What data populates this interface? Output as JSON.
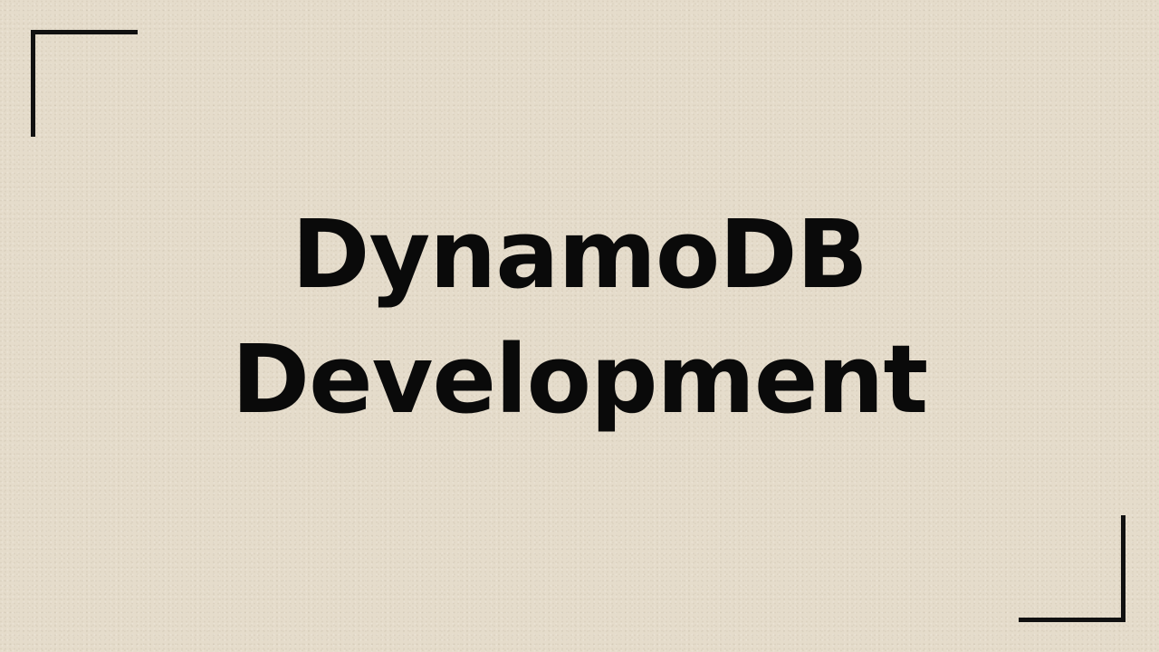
{
  "slide": {
    "title_line_1": "DynamoDB",
    "title_line_2": "Development"
  },
  "colors": {
    "background": "#e5dccb",
    "text": "#0a0a0a",
    "corner_marks": "#111111"
  }
}
